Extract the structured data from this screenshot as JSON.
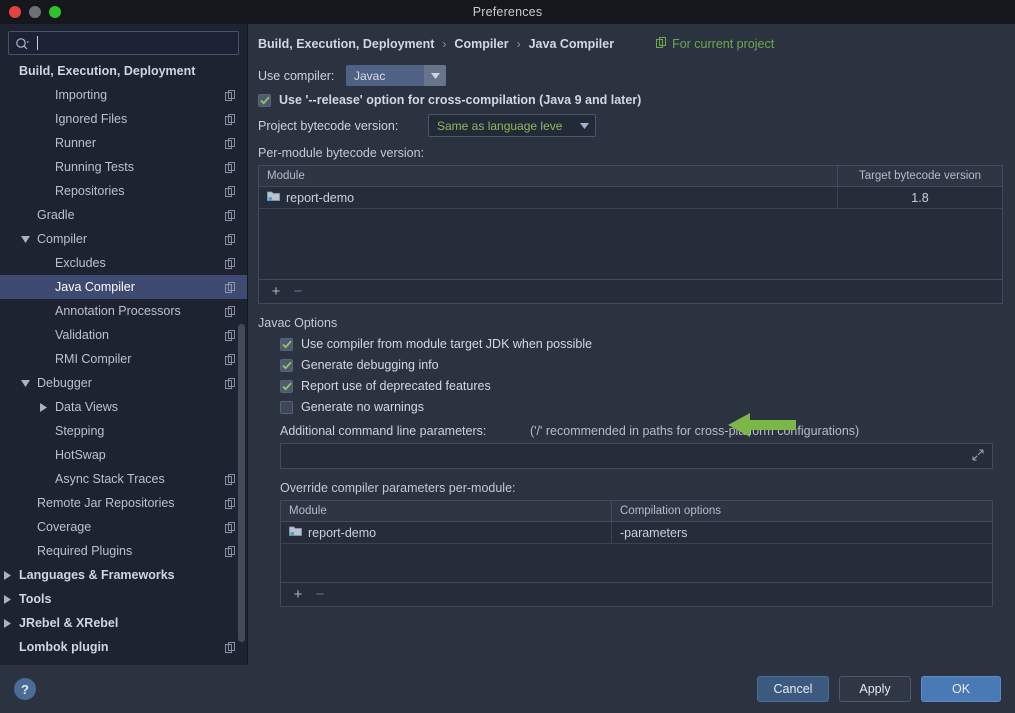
{
  "window": {
    "title": "Preferences"
  },
  "traffic": {
    "close": "close-window",
    "minimize": "minimize-window",
    "zoom": "zoom-window"
  },
  "search": {
    "value": "",
    "placeholder": ""
  },
  "sidebar": {
    "items": [
      {
        "label": "Build, Execution, Deployment",
        "depth": 0,
        "bold": true,
        "twisty": "none",
        "icon": false,
        "selected": false
      },
      {
        "label": "Importing",
        "depth": 2,
        "bold": false,
        "twisty": "none",
        "icon": true,
        "selected": false
      },
      {
        "label": "Ignored Files",
        "depth": 2,
        "bold": false,
        "twisty": "none",
        "icon": true,
        "selected": false
      },
      {
        "label": "Runner",
        "depth": 2,
        "bold": false,
        "twisty": "none",
        "icon": true,
        "selected": false
      },
      {
        "label": "Running Tests",
        "depth": 2,
        "bold": false,
        "twisty": "none",
        "icon": true,
        "selected": false
      },
      {
        "label": "Repositories",
        "depth": 2,
        "bold": false,
        "twisty": "none",
        "icon": true,
        "selected": false
      },
      {
        "label": "Gradle",
        "depth": 1,
        "bold": false,
        "twisty": "none",
        "icon": true,
        "selected": false
      },
      {
        "label": "Compiler",
        "depth": 1,
        "bold": false,
        "twisty": "expanded",
        "icon": true,
        "selected": false
      },
      {
        "label": "Excludes",
        "depth": 2,
        "bold": false,
        "twisty": "none",
        "icon": true,
        "selected": false
      },
      {
        "label": "Java Compiler",
        "depth": 2,
        "bold": false,
        "twisty": "none",
        "icon": true,
        "selected": true
      },
      {
        "label": "Annotation Processors",
        "depth": 2,
        "bold": false,
        "twisty": "none",
        "icon": true,
        "selected": false
      },
      {
        "label": "Validation",
        "depth": 2,
        "bold": false,
        "twisty": "none",
        "icon": true,
        "selected": false
      },
      {
        "label": "RMI Compiler",
        "depth": 2,
        "bold": false,
        "twisty": "none",
        "icon": true,
        "selected": false
      },
      {
        "label": "Debugger",
        "depth": 1,
        "bold": false,
        "twisty": "expanded",
        "icon": true,
        "selected": false
      },
      {
        "label": "Data Views",
        "depth": 2,
        "bold": false,
        "twisty": "collapsed",
        "icon": false,
        "selected": false
      },
      {
        "label": "Stepping",
        "depth": 2,
        "bold": false,
        "twisty": "none",
        "icon": false,
        "selected": false
      },
      {
        "label": "HotSwap",
        "depth": 2,
        "bold": false,
        "twisty": "none",
        "icon": false,
        "selected": false
      },
      {
        "label": "Async Stack Traces",
        "depth": 2,
        "bold": false,
        "twisty": "none",
        "icon": true,
        "selected": false
      },
      {
        "label": "Remote Jar Repositories",
        "depth": 1,
        "bold": false,
        "twisty": "none",
        "icon": true,
        "selected": false
      },
      {
        "label": "Coverage",
        "depth": 1,
        "bold": false,
        "twisty": "none",
        "icon": true,
        "selected": false
      },
      {
        "label": "Required Plugins",
        "depth": 1,
        "bold": false,
        "twisty": "none",
        "icon": true,
        "selected": false
      },
      {
        "label": "Languages & Frameworks",
        "depth": 0,
        "bold": true,
        "twisty": "collapsed",
        "icon": false,
        "selected": false
      },
      {
        "label": "Tools",
        "depth": 0,
        "bold": true,
        "twisty": "collapsed",
        "icon": false,
        "selected": false
      },
      {
        "label": "JRebel & XRebel",
        "depth": 0,
        "bold": true,
        "twisty": "collapsed",
        "icon": false,
        "selected": false
      },
      {
        "label": "Lombok plugin",
        "depth": 0,
        "bold": true,
        "twisty": "none",
        "icon": true,
        "selected": false
      }
    ]
  },
  "breadcrumb": {
    "items": [
      "Build, Execution, Deployment",
      "Compiler",
      "Java Compiler"
    ],
    "separator": "›",
    "scope_label": "For current project",
    "scope_color": "#6fa84f"
  },
  "compiler": {
    "use_compiler_label": "Use compiler:",
    "use_compiler_value": "Javac",
    "release_option_label": "Use '--release' option for cross-compilation (Java 9 and later)",
    "release_option_checked": true,
    "project_bytecode_label": "Project bytecode version:",
    "project_bytecode_value": "Same as language leve",
    "per_module_label": "Per-module bytecode version:"
  },
  "bytecode_table": {
    "columns": [
      "Module",
      "Target bytecode version"
    ],
    "rows": [
      {
        "module": "report-demo",
        "target": "1.8"
      }
    ],
    "add_label": "+",
    "remove_label": "−"
  },
  "javac_options": {
    "title": "Javac Options",
    "checkboxes": [
      {
        "label": "Use compiler from module target JDK when possible",
        "checked": true
      },
      {
        "label": "Generate debugging info",
        "checked": true
      },
      {
        "label": "Report use of deprecated features",
        "checked": true
      },
      {
        "label": "Generate no warnings",
        "checked": false
      }
    ],
    "additional_params_label": "Additional command line parameters:",
    "additional_params_hint": "('/' recommended in paths for cross-platform configurations)",
    "additional_params_value": "",
    "override_label": "Override compiler parameters per-module:"
  },
  "override_table": {
    "columns": [
      "Module",
      "Compilation options"
    ],
    "rows": [
      {
        "module": "report-demo",
        "options": "-parameters"
      }
    ],
    "add_label": "+",
    "remove_label": "−"
  },
  "annotation": {
    "arrow_color": "#7ab648",
    "points_at": "Generate debugging info"
  },
  "footer": {
    "help_label": "?",
    "cancel_label": "Cancel",
    "apply_label": "Apply",
    "ok_label": "OK"
  }
}
